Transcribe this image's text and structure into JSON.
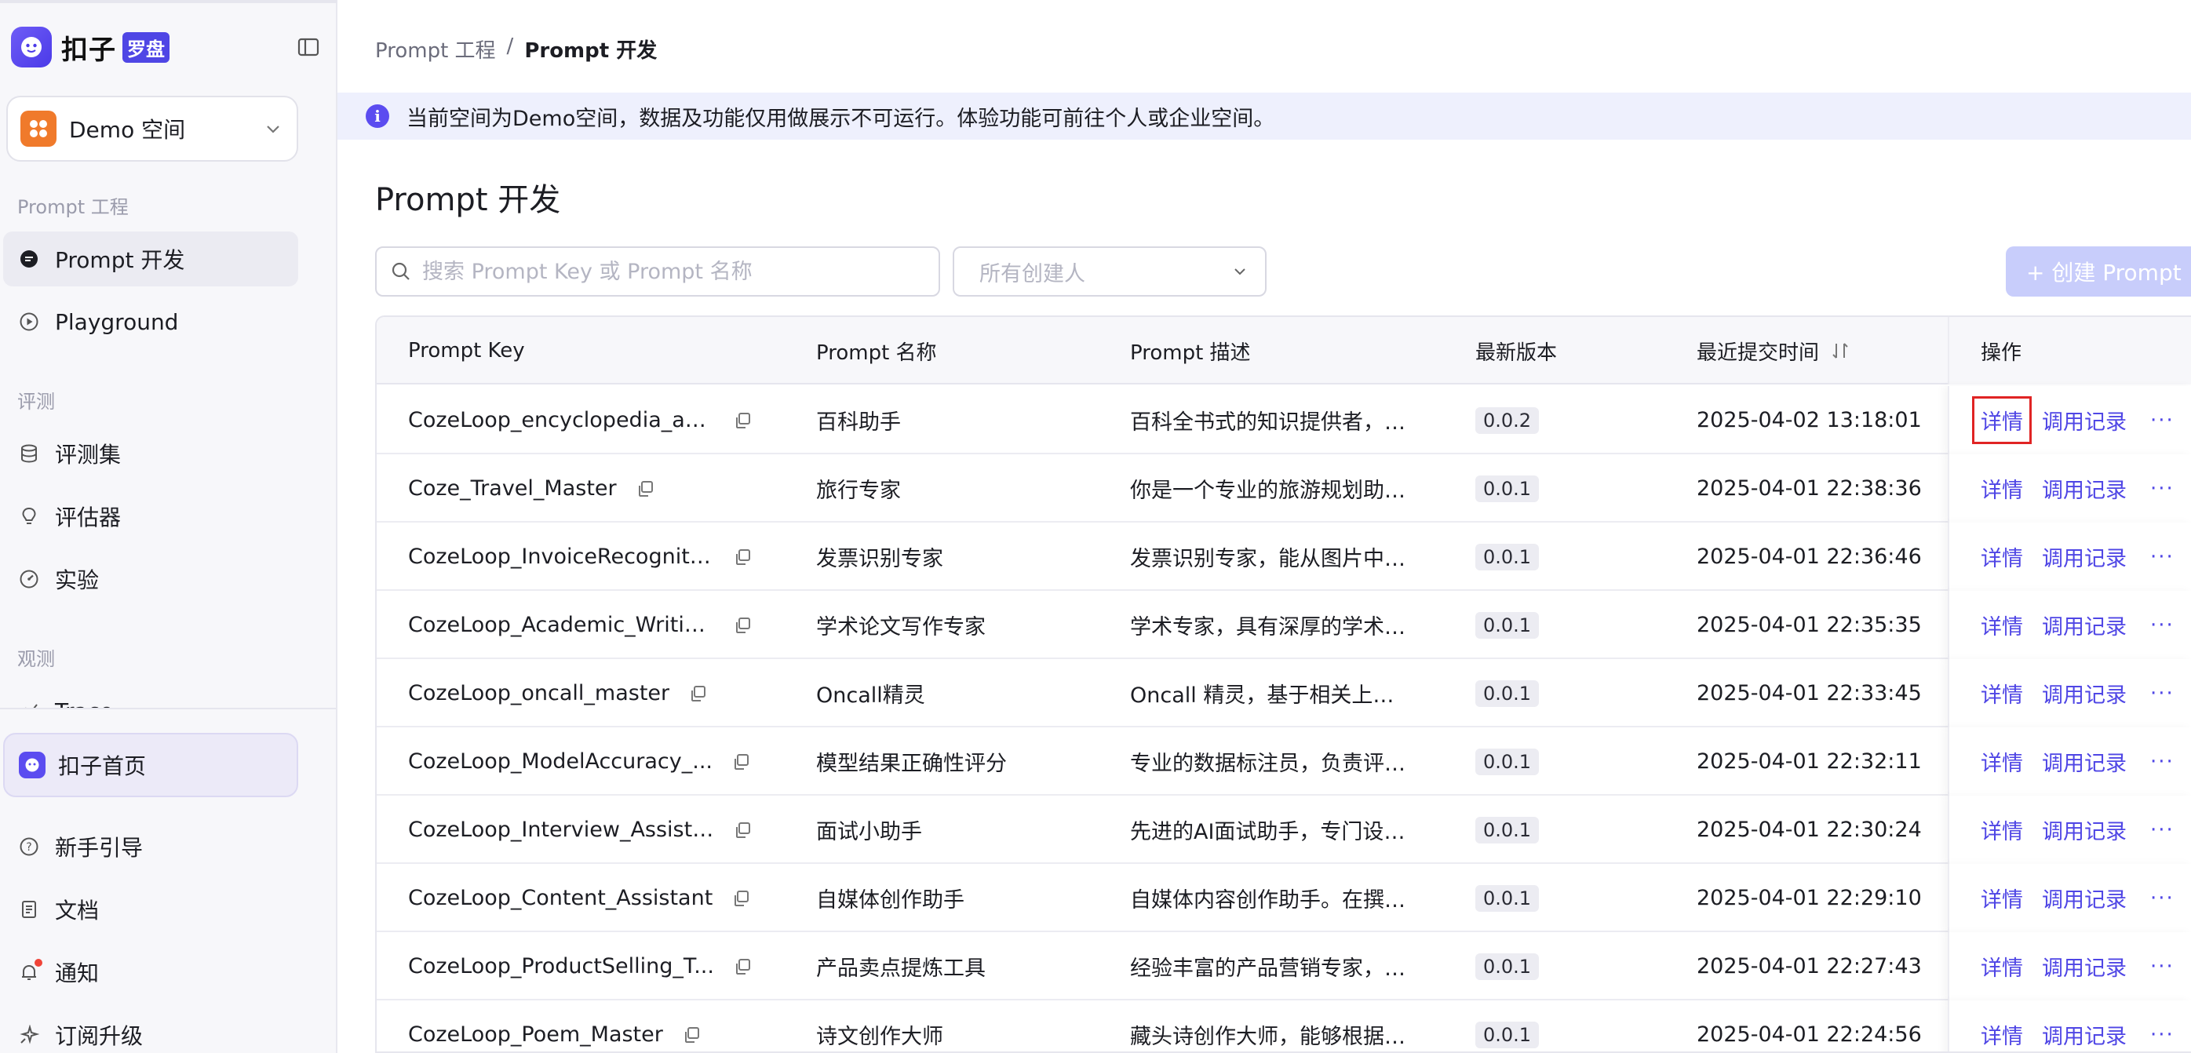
{
  "brand": {
    "name": "扣子",
    "badge": "罗盘"
  },
  "space": {
    "name": "Demo 空间"
  },
  "nav": {
    "sections": [
      {
        "label": "Prompt 工程"
      },
      {
        "label": "评测"
      },
      {
        "label": "观测"
      }
    ],
    "items": [
      {
        "label": "Prompt 开发",
        "active": true,
        "icon": "chat-icon"
      },
      {
        "label": "Playground",
        "active": false,
        "icon": "play-circle-icon"
      },
      {
        "label": "评测集",
        "active": false,
        "icon": "database-icon"
      },
      {
        "label": "评估器",
        "active": false,
        "icon": "bulb-icon"
      },
      {
        "label": "实验",
        "active": false,
        "icon": "gauge-icon"
      },
      {
        "label": "Trace",
        "active": false,
        "icon": "trace-icon"
      }
    ]
  },
  "bottom": {
    "home": "扣子首页",
    "guide": "新手引导",
    "docs": "文档",
    "notify": "通知",
    "upgrade": "订阅升级"
  },
  "breadcrumb": {
    "parent": "Prompt 工程",
    "separator": "/",
    "current": "Prompt 开发"
  },
  "notice": {
    "text": "当前空间为Demo空间，数据及功能仅用做展示不可运行。体验功能可前往个人或企业空间。"
  },
  "page": {
    "title": "Prompt 开发"
  },
  "filters": {
    "search_placeholder": "搜索 Prompt Key 或 Prompt 名称",
    "creator_placeholder": "所有创建人",
    "create_label": "+ 创建 Prompt"
  },
  "table": {
    "headers": {
      "key": "Prompt Key",
      "name": "Prompt 名称",
      "desc": "Prompt 描述",
      "version": "最新版本",
      "time": "最近提交时间",
      "ops": "操作"
    },
    "ops": {
      "detail": "详情",
      "records": "调用记录",
      "more": "···"
    },
    "rows": [
      {
        "key": "CozeLoop_encyclopedia_as...",
        "name": "百科助手",
        "desc": "百科全书式的知识提供者，通...",
        "version": "0.0.2",
        "time": "2025-04-02 13:18:01"
      },
      {
        "key": "Coze_Travel_Master",
        "name": "旅行专家",
        "desc": "你是一个专业的旅游规划助手...",
        "version": "0.0.1",
        "time": "2025-04-01 22:38:36"
      },
      {
        "key": "CozeLoop_InvoiceRecogniti...",
        "name": "发票识别专家",
        "desc": "发票识别专家，能从图片中提...",
        "version": "0.0.1",
        "time": "2025-04-01 22:36:46"
      },
      {
        "key": "CozeLoop_Academic_Writin...",
        "name": "学术论文写作专家",
        "desc": "学术专家，具有深厚的学术背...",
        "version": "0.0.1",
        "time": "2025-04-01 22:35:35"
      },
      {
        "key": "CozeLoop_oncall_master",
        "name": "Oncall精灵",
        "desc": "Oncall 精灵，基于相关上下...",
        "version": "0.0.1",
        "time": "2025-04-01 22:33:45"
      },
      {
        "key": "CozeLoop_ModelAccuracy_...",
        "name": "模型结果正确性评分",
        "desc": "专业的数据标注员，负责评估...",
        "version": "0.0.1",
        "time": "2025-04-01 22:32:11"
      },
      {
        "key": "CozeLoop_Interview_Assista...",
        "name": "面试小助手",
        "desc": "先进的AI面试助手，专门设计...",
        "version": "0.0.1",
        "time": "2025-04-01 22:30:24"
      },
      {
        "key": "CozeLoop_Content_Assistant",
        "name": "自媒体创作助手",
        "desc": "自媒体内容创作助手。在撰写...",
        "version": "0.0.1",
        "time": "2025-04-01 22:29:10"
      },
      {
        "key": "CozeLoop_ProductSelling_T...",
        "name": "产品卖点提炼工具",
        "desc": "经验丰富的产品营销专家，擅...",
        "version": "0.0.1",
        "time": "2025-04-01 22:27:43"
      },
      {
        "key": "CozeLoop_Poem_Master",
        "name": "诗文创作大师",
        "desc": "藏头诗创作大师，能够根据用...",
        "version": "0.0.1",
        "time": "2025-04-01 22:24:56"
      }
    ]
  }
}
